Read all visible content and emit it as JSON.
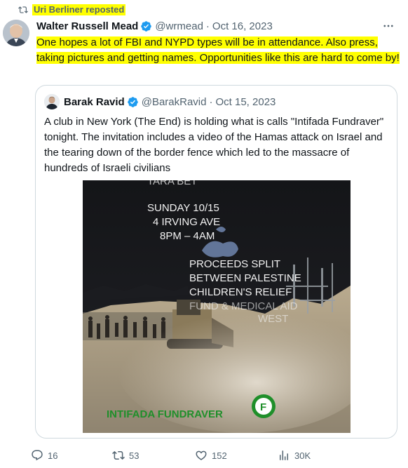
{
  "repost": {
    "label": "Uri Berliner reposted",
    "icon": "repost-icon"
  },
  "tweet": {
    "author_name": "Walter Russell Mead",
    "handle": "@wrmead",
    "separator": "·",
    "date": "Oct 16, 2023",
    "text": "One hopes a lot of FBI and NYPD types will be in attendance. Also press, taking pictures and getting names. Opportunities like this are hard to come by!",
    "highlight_color": "#ffff00"
  },
  "quote": {
    "author_name": "Barak Ravid",
    "handle": "@BarakRavid",
    "separator": "·",
    "date": "Oct 15, 2023",
    "text": "A club in New York (The End) is holding what is calls \"Intifada Fundraver\" tonight. The invitation includes a video of the Hamas attack on Israel and the tearing down of the border fence which led to the massacre of hundreds of Israeli civilians",
    "media": {
      "line_top": "TARA BET",
      "line_day": "SUNDAY 10/15",
      "line_address": "4 IRVING AVE",
      "line_time": "8PM – 4AM",
      "line_p1": "PROCEEDS SPLIT",
      "line_p2": "BETWEEN PALESTINE",
      "line_p3": "CHILDREN'S RELIEF",
      "line_p4": "FUND & MEDICAL AID",
      "line_p5": "WEST",
      "banner": "INTIFADA FUNDRAVER",
      "logo_letter": "F"
    }
  },
  "actions": {
    "replies": "16",
    "reposts": "53",
    "likes": "152",
    "views": "30K"
  },
  "colors": {
    "secondary_text": "#536471",
    "verified_blue": "#1d9bf0",
    "border": "#cfd9de",
    "highlight": "#ffff00"
  }
}
